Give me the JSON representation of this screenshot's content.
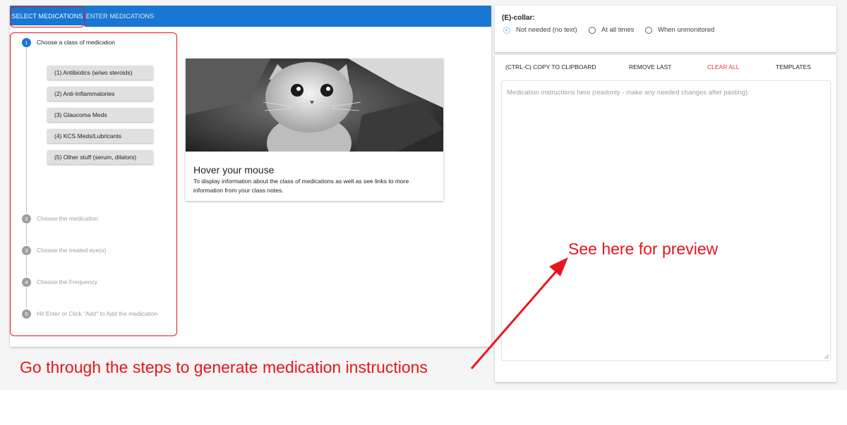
{
  "tabs": {
    "select": "SELECT MEDICATIONS",
    "enter": "ENTER MEDICATIONS"
  },
  "steps": [
    {
      "number": "1",
      "label": "Choose a class of medication"
    },
    {
      "number": "2",
      "label": "Choose the medication"
    },
    {
      "number": "3",
      "label": "Choose the treated eye(s)"
    },
    {
      "number": "4",
      "label": "Choose the Frequency"
    },
    {
      "number": "5",
      "label": "Hit Enter or Click \"Add\" to Add the medication"
    }
  ],
  "med_classes": [
    "(1) Antibiotics (w/wo steroids)",
    "(2) Anti-Inflammatories",
    "(3) Glaucoma Meds",
    "(4) KCS Meds/Lubricants",
    "(5) Other stuff (serum, dilators)"
  ],
  "card": {
    "title": "Hover your mouse",
    "text": "To display information about the class of medications as well as see links to more information from your class notes."
  },
  "ecollar": {
    "label": "(E)-collar:",
    "options": [
      "Not needed (no text)",
      "At all times",
      "When unmonitored"
    ],
    "selected": "Not needed (no text)"
  },
  "toolbar": {
    "copy": "(CTRL-C) COPY TO CLIPBOARD",
    "remove_last": "REMOVE LAST",
    "clear_all": "CLEAR ALL",
    "templates": "TEMPLATES"
  },
  "preview": {
    "placeholder": "Medication instructions here (readonly - make any needed changes after pasting)."
  },
  "annotations": {
    "preview_note": "See here for preview",
    "steps_note": "Go through the steps to generate medication instructions"
  },
  "colors": {
    "primary": "#1976d2",
    "annotation": "#e8151d",
    "danger": "#e53935"
  }
}
